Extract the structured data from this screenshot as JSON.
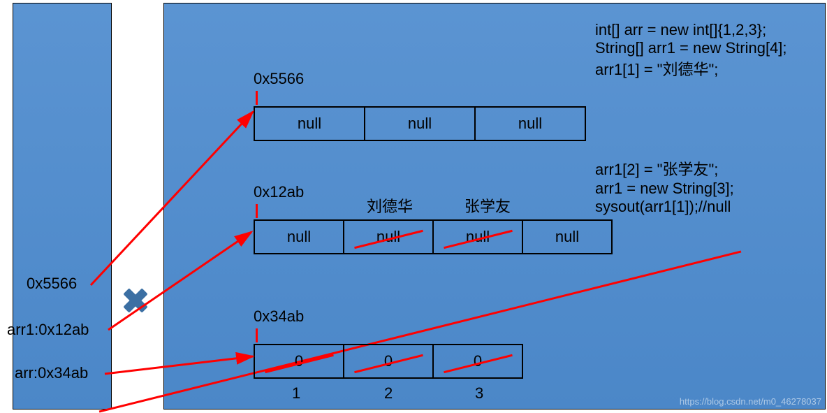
{
  "colors": {
    "panel": "#4b87c8",
    "arrow": "#ff0000"
  },
  "stack": {
    "addr_5566": "0x5566",
    "arr1_line": "arr1:0x12ab",
    "arr_line": "arr:0x34ab"
  },
  "heap": {
    "arr1_new": {
      "addr": "0x5566",
      "cells": [
        "null",
        "null",
        "null"
      ]
    },
    "arr1_old": {
      "addr": "0x12ab",
      "overwrite_labels": [
        "刘德华",
        "张学友"
      ],
      "cells": [
        "null",
        "null",
        "null",
        "null"
      ],
      "struck": [
        false,
        true,
        true,
        false
      ]
    },
    "arr_int": {
      "addr": "0x34ab",
      "cells": [
        "0",
        "0",
        "0"
      ],
      "struck": [
        true,
        true,
        true
      ],
      "indices": [
        "1",
        "2",
        "3"
      ]
    }
  },
  "code_top": "int[] arr = new int[]{1,2,3};\nString[] arr1 = new String[4];\narr1[1] = \"刘德华\";",
  "code_bottom": "arr1[2] = \"张学友\";\narr1 = new String[3];\nsysout(arr1[1]);//null",
  "watermark": "https://blog.csdn.net/m0_46278037"
}
